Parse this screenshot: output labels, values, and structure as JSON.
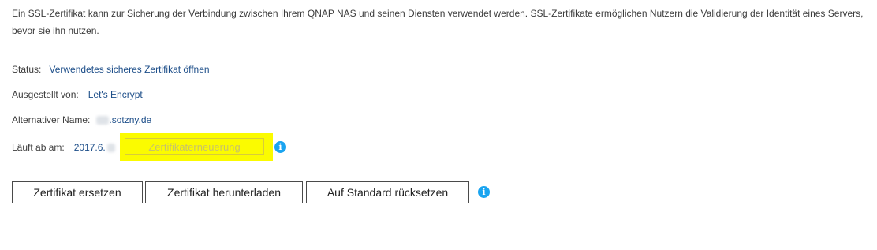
{
  "intro": {
    "line1": "Ein SSL-Zertifikat kann zur Sicherung der Verbindung zwischen Ihrem QNAP NAS und seinen Diensten verwendet werden. SSL-Zertifikate ermöglichen Nutzern die Validierung der Identität eines Servers,",
    "line2": "bevor sie ihn nutzen."
  },
  "status": {
    "label": "Status:",
    "link": "Verwendetes sicheres Zertifikat öffnen"
  },
  "issuer": {
    "label": "Ausgestellt von:",
    "value": "Let's Encrypt"
  },
  "alt_name": {
    "label": "Alternativer Name:",
    "value": ".sotzny.de"
  },
  "expires": {
    "label": "Läuft ab am:",
    "value": "2017.6."
  },
  "renew_button": "Zertifikaterneuerung",
  "buttons": {
    "replace": "Zertifikat ersetzen",
    "download": "Zertifikat herunterladen",
    "reset": "Auf Standard rücksetzen"
  },
  "icons": {
    "info": "info-icon",
    "info_color": "#1aa4f0",
    "highlight_color": "#fbfb00"
  }
}
